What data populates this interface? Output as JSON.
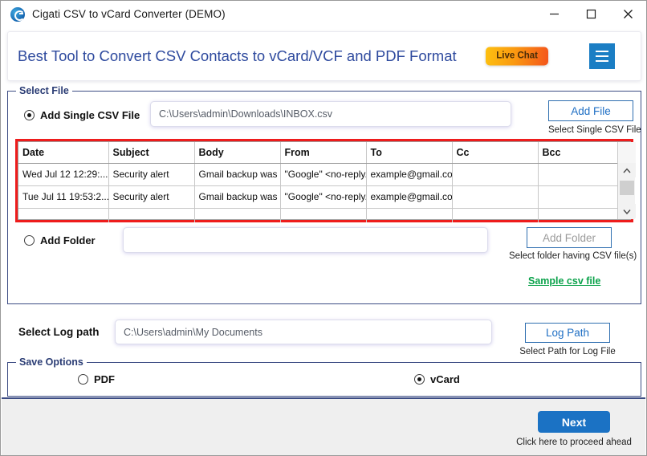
{
  "window": {
    "title": "Cigati CSV to vCard Converter (DEMO)",
    "logo_icon": "cigati-logo-icon",
    "controls": {
      "minimize": "minimize-icon",
      "maximize": "maximize-icon",
      "close": "close-icon"
    }
  },
  "banner": {
    "headline": "Best Tool to Convert CSV Contacts to vCard/VCF and PDF Format",
    "live_chat_label": "Live Chat",
    "menu_icon": "hamburger-menu-icon",
    "headline_color": "#2e4a9e",
    "menu_color": "#1b7ec4"
  },
  "select_file": {
    "legend": "Select File",
    "single_file": {
      "radio_label": "Add Single CSV File",
      "selected": true,
      "path_value": "C:\\Users\\admin\\Downloads\\INBOX.csv",
      "button_label": "Add File",
      "hint": "Select Single CSV File"
    },
    "folder": {
      "radio_label": "Add Folder",
      "selected": false,
      "path_value": "",
      "button_label": "Add Folder",
      "button_disabled": true,
      "hint": "Select folder having CSV file(s)"
    },
    "sample_link": "Sample csv file",
    "sample_link_color": "#0aa24a",
    "highlight_color": "#ee1c1c"
  },
  "grid": {
    "columns": [
      "Date",
      "Subject",
      "Body",
      "From",
      "To",
      "Cc",
      "Bcc"
    ],
    "rows": [
      {
        "Date": "Wed Jul 12 12:29:...",
        "Subject": "Security alert",
        "Body": "Gmail backup was g...",
        "From": "\"Google\" <no-reply...",
        "To": "example@gmail.com",
        "Cc": "",
        "Bcc": ""
      },
      {
        "Date": "Tue Jul 11 19:53:2...",
        "Subject": "Security alert",
        "Body": "Gmail backup was g...",
        "From": "\"Google\" <no-reply...",
        "To": "example@gmail.com",
        "Cc": "",
        "Bcc": ""
      }
    ],
    "scrollbar": {
      "up_icon": "chevron-up-icon",
      "down_icon": "chevron-down-icon"
    }
  },
  "log_path": {
    "label": "Select Log path",
    "value": "C:\\Users\\admin\\My Documents",
    "button_label": "Log Path",
    "hint": "Select Path for Log File"
  },
  "save_options": {
    "legend": "Save Options",
    "options": [
      {
        "label": "PDF",
        "selected": false
      },
      {
        "label": "vCard",
        "selected": true
      }
    ]
  },
  "footer": {
    "next_label": "Next",
    "next_hint": "Click here to proceed ahead",
    "next_color": "#1b72c4"
  }
}
